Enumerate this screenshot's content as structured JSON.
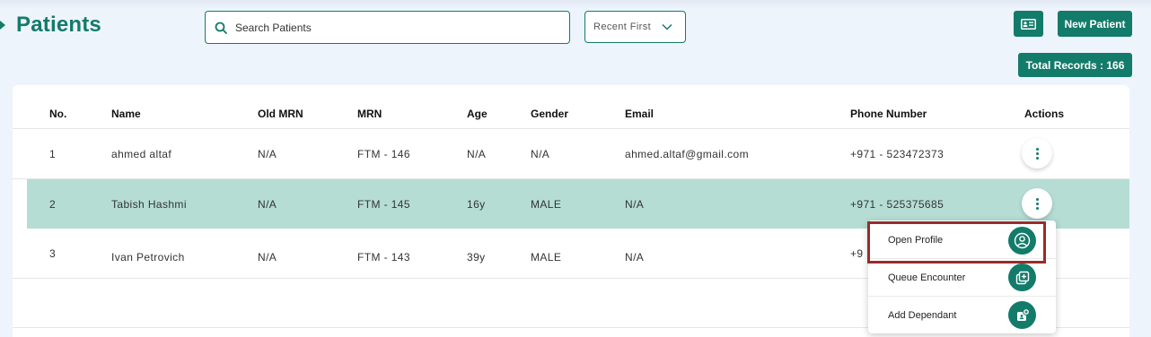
{
  "page": {
    "title": "Patients",
    "search_placeholder": "Search Patients",
    "sort_value": "Recent First",
    "new_patient_label": "New Patient",
    "total_records_label": "Total Records : 166"
  },
  "table": {
    "columns": [
      "No.",
      "Name",
      "Old MRN",
      "MRN",
      "Age",
      "Gender",
      "Email",
      "Phone Number",
      "Actions"
    ],
    "rows": [
      {
        "no": "1",
        "name": "ahmed altaf",
        "old_mrn": "N/A",
        "mrn": "FTM - 146",
        "age": "N/A",
        "gender": "N/A",
        "email": "ahmed.altaf@gmail.com",
        "phone": "+971 - 523472373"
      },
      {
        "no": "2",
        "name": "Tabish Hashmi",
        "old_mrn": "N/A",
        "mrn": "FTM - 145",
        "age": "16y",
        "gender": "MALE",
        "email": "N/A",
        "phone": "+971 - 525375685"
      },
      {
        "no": "3",
        "name": "Ivan Petrovich",
        "old_mrn": "N/A",
        "mrn": "FTM - 143",
        "age": "39y",
        "gender": "MALE",
        "email": "N/A",
        "phone": "+9"
      }
    ]
  },
  "actions_menu": {
    "items": [
      {
        "label": "Open Profile",
        "icon": "user-circle-icon"
      },
      {
        "label": "Queue Encounter",
        "icon": "queue-add-icon"
      },
      {
        "label": "Add Dependant",
        "icon": "add-dependant-icon"
      }
    ]
  },
  "colors": {
    "brand": "#137b6a",
    "selected_row": "#b5ddd4",
    "page_bg": "#eef4fc",
    "highlight": "#992b2b"
  }
}
